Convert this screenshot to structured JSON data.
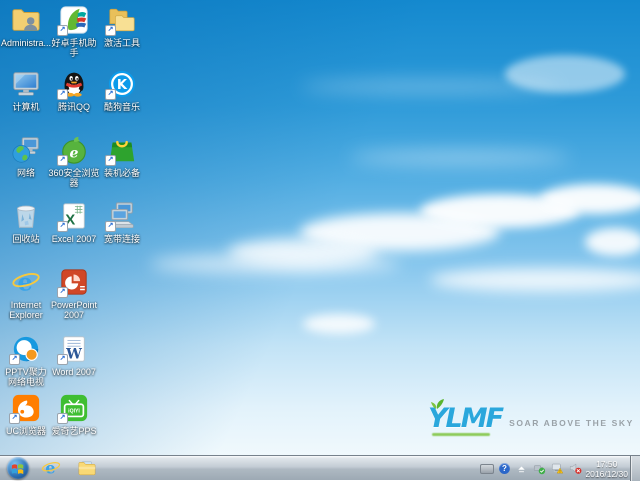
{
  "desktop": {
    "icons": [
      {
        "label": "Administra..."
      },
      {
        "label": "好卓手机助手"
      },
      {
        "label": "激活工具"
      },
      {
        "label": "计算机"
      },
      {
        "label": "腾讯QQ"
      },
      {
        "label": "酷狗音乐"
      },
      {
        "label": "网络"
      },
      {
        "label": "360安全浏览器"
      },
      {
        "label": "装机必备"
      },
      {
        "label": "回收站"
      },
      {
        "label": "Excel 2007"
      },
      {
        "label": "宽带连接"
      },
      {
        "label": "Internet Explorer"
      },
      {
        "label": "PowerPoint 2007"
      },
      {
        "label": "PPTV聚力 网络电视"
      },
      {
        "label": "Word 2007"
      },
      {
        "label": "UC浏览器"
      },
      {
        "label": "爱奇艺PPS"
      }
    ],
    "logo": {
      "brand": "YLMF",
      "tagline": "SOAR ABOVE THE SKY"
    },
    "colors": {
      "sky_top": "#1489cf",
      "sky_bottom": "#f5fbfd",
      "logo_blue": "#2aa7dc",
      "tagline_gray": "#9aa2a8"
    }
  },
  "taskbar": {
    "tray": {
      "question_badge": "?"
    },
    "clock": {
      "time": "17:50",
      "date": "2016/12/30"
    }
  }
}
